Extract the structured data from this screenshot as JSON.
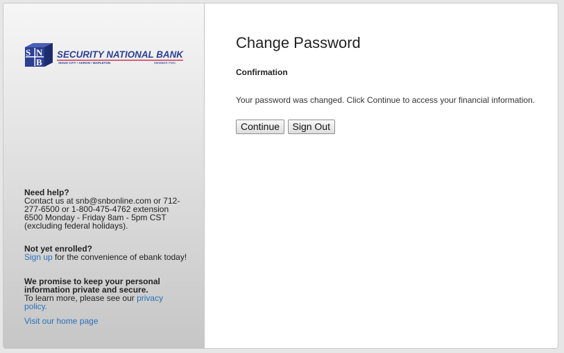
{
  "sidebar": {
    "logo": {
      "monogram": "SNB",
      "bank_name": "SECURITY NATIONAL BANK",
      "locations": "SIOUX CITY • AKRON • MAPLETON",
      "fdic": "MEMBER FDIC"
    },
    "help": {
      "heading": "Need help?",
      "text": "Contact us at snb@snbonline.com or 712-277-6500 or 1-800-475-4762 extension 6500 Monday - Friday 8am - 5pm CST (excluding federal holidays)."
    },
    "enroll": {
      "heading": "Not yet enrolled?",
      "link": "Sign up",
      "text": " for the convenience of ebank today!"
    },
    "privacy": {
      "heading": "We promise to keep your personal information private and secure.",
      "text": "To learn more, please see our ",
      "link": "privacy policy."
    },
    "home_link": "Visit our home page"
  },
  "main": {
    "title": "Change Password",
    "subtitle": "Confirmation",
    "message": "Your password was changed. Click Continue to access your financial information.",
    "continue_label": "Continue",
    "signout_label": "Sign Out"
  },
  "colors": {
    "brand_blue": "#2b3f93",
    "link": "#2a6fb8",
    "fdic_red": "#c8102e"
  }
}
